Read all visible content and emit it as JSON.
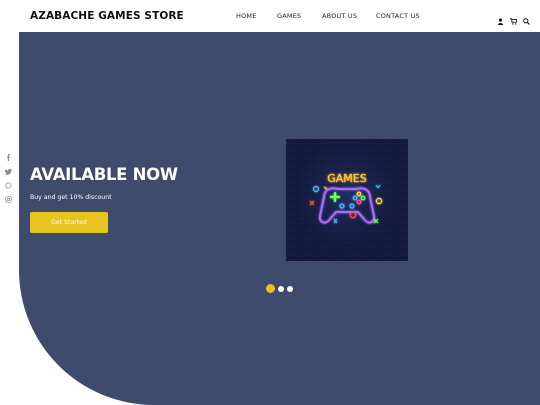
{
  "header": {
    "brand": "AZABACHE GAMES STORE",
    "nav": [
      "HOME",
      "GAMES",
      "ABOUT US",
      "CONTACT US"
    ],
    "icons": [
      "user-icon",
      "cart-icon",
      "search-icon"
    ]
  },
  "social": [
    "facebook-icon",
    "twitter-icon",
    "whatsapp-icon",
    "instagram-icon"
  ],
  "hero": {
    "headline": "AVAILABLE NOW",
    "subtitle": "Buy and get 10% discount",
    "cta_label": "Get Started",
    "art_label": "GAMES",
    "slides_total": 3,
    "active_slide": 1
  },
  "colors": {
    "hero_bg": "#3e4b6d",
    "accent": "#e7c320",
    "header_bg": "#ffffff"
  }
}
